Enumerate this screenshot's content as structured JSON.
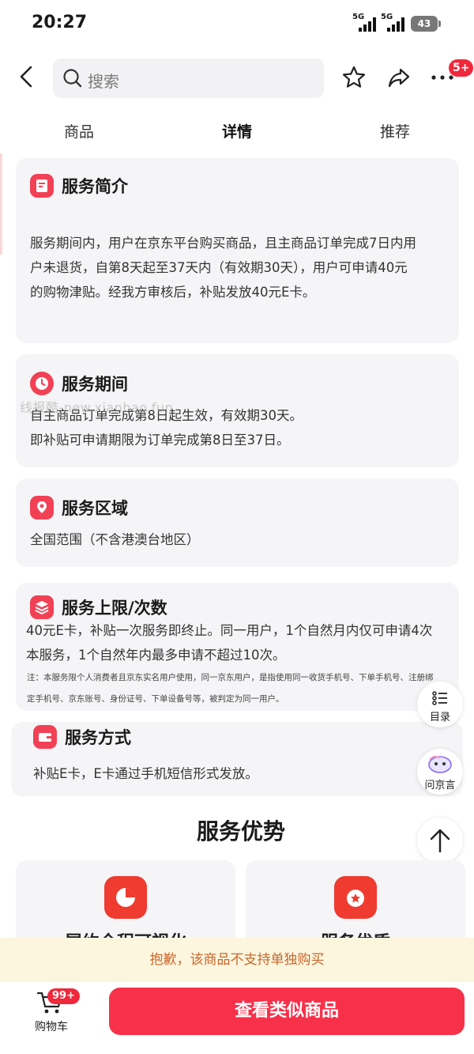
{
  "status_bar": {
    "time": "20:27",
    "network_1": "5G",
    "network_2": "5G",
    "battery": "43"
  },
  "nav": {
    "search_placeholder": "搜索",
    "more_badge": "5+"
  },
  "tabs": [
    {
      "label": "商品",
      "active": false
    },
    {
      "label": "详情",
      "active": true
    },
    {
      "label": "推荐",
      "active": false
    }
  ],
  "sections": {
    "intro": {
      "title": "服务简介",
      "lines": [
        "服务期间内，用户在京东平台购买商品，且主商品订单完成7日内用",
        "户未退货，自第8天起至37天内（有效期30天），用户可申请40元",
        "的购物津贴。经我方审核后，补贴发放40元E卡。"
      ]
    },
    "period": {
      "title": "服务期间",
      "lines": [
        "自主商品订单完成第8日起生效，有效期30天。",
        "即补贴可申请期限为订单完成第8日至37日。"
      ]
    },
    "region": {
      "title": "服务区域",
      "lines": [
        "全国范围（不含港澳台地区）"
      ]
    },
    "limit": {
      "title": "服务上限/次数",
      "lines": [
        "40元E卡，补贴一次服务即终止。同一用户，1个自然月内仅可申请4次",
        "本服务，1个自然年内最多申请不超过10次。"
      ],
      "note_lines": [
        "注：本服务限个人消费者且京东实名用户使用，同一京东用户，是指使用同一收货手机号、下单手机号、注册绑",
        "定手机号、京东账号、身份证号、下单设备号等，被判定为同一用户。"
      ]
    },
    "method": {
      "title": "服务方式",
      "lines": [
        "补贴E卡，E卡通过手机短信形式发放。"
      ]
    }
  },
  "watermark": "线报酷-new.xianbao.fun",
  "floating": {
    "toc_label": "目录",
    "assistant_label": "问京言"
  },
  "advantages": {
    "title": "服务优势",
    "items": [
      {
        "label": "履约全程可视化"
      },
      {
        "label": "服务优质"
      }
    ]
  },
  "notice": "抱歉，该商品不支持单独购买",
  "bottom": {
    "cart_label": "购物车",
    "cart_badge": "99+",
    "cta": "查看类似商品"
  },
  "colors": {
    "accent": "#f24055",
    "cta": "#f8314a",
    "notice_bg": "#fdf6de",
    "notice_text": "#c8662b",
    "card_bg": "#f5f5f7"
  }
}
